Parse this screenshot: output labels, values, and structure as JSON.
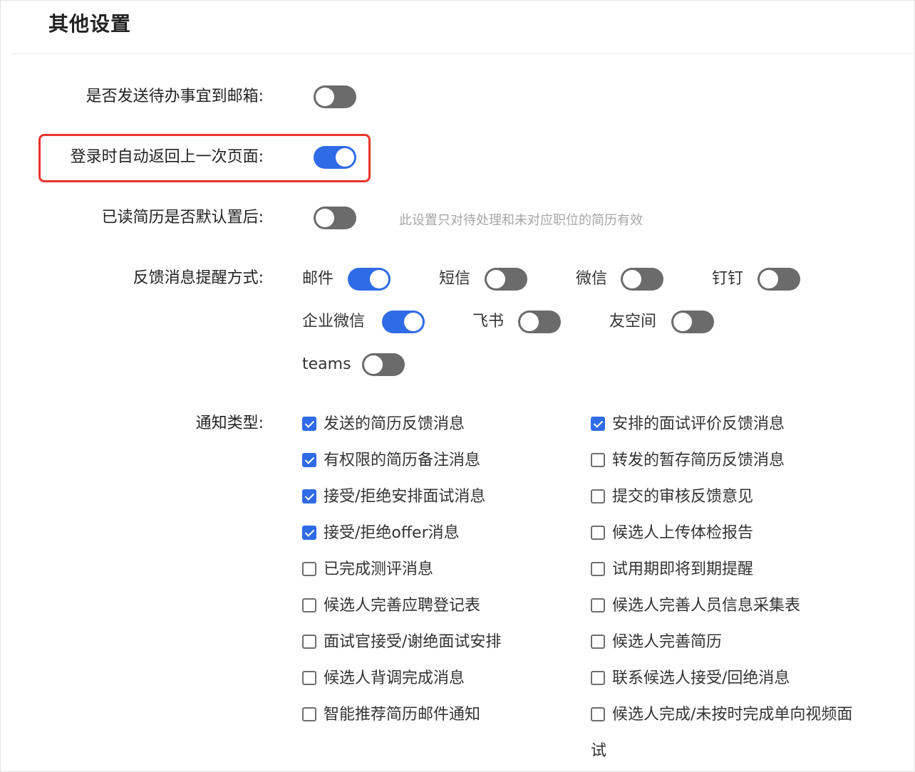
{
  "section_title": "其他设置",
  "settings": {
    "email_todo": {
      "label": "是否发送待办事宜到邮箱:",
      "enabled": false
    },
    "auto_return": {
      "label": "登录时自动返回上一次页面:",
      "enabled": true
    },
    "read_resume_last": {
      "label": "已读简历是否默认置后:",
      "enabled": false,
      "hint": "此设置只对待处理和未对应职位的简历有效"
    }
  },
  "reminder": {
    "label": "反馈消息提醒方式:",
    "channels": [
      {
        "label": "邮件",
        "enabled": true
      },
      {
        "label": "短信",
        "enabled": false
      },
      {
        "label": "微信",
        "enabled": false
      },
      {
        "label": "钉钉",
        "enabled": false
      },
      {
        "label": "企业微信",
        "enabled": true
      },
      {
        "label": "飞书",
        "enabled": false
      },
      {
        "label": "友空间",
        "enabled": false
      },
      {
        "label": "teams",
        "enabled": false
      }
    ]
  },
  "notify": {
    "label": "通知类型:",
    "left": [
      {
        "label": "发送的简历反馈消息",
        "checked": true
      },
      {
        "label": "有权限的简历备注消息",
        "checked": true
      },
      {
        "label": "接受/拒绝安排面试消息",
        "checked": true
      },
      {
        "label": "接受/拒绝offer消息",
        "checked": true
      },
      {
        "label": "已完成测评消息",
        "checked": false
      },
      {
        "label": "候选人完善应聘登记表",
        "checked": false
      },
      {
        "label": "面试官接受/谢绝面试安排",
        "checked": false
      },
      {
        "label": "候选人背调完成消息",
        "checked": false
      },
      {
        "label": "智能推荐简历邮件通知",
        "checked": false
      }
    ],
    "right": [
      {
        "label": "安排的面试评价反馈消息",
        "checked": true
      },
      {
        "label": "转发的暂存简历反馈消息",
        "checked": false
      },
      {
        "label": "提交的审核反馈意见",
        "checked": false
      },
      {
        "label": "候选人上传体检报告",
        "checked": false
      },
      {
        "label": "试用期即将到期提醒",
        "checked": false
      },
      {
        "label": "候选人完善人员信息采集表",
        "checked": false
      },
      {
        "label": "候选人完善简历",
        "checked": false
      },
      {
        "label": "联系候选人接受/回绝消息",
        "checked": false
      },
      {
        "label": "候选人完成/未按时完成单向视频面",
        "checked": false,
        "wrap": "试"
      }
    ]
  },
  "colors": {
    "accent": "#2f6be6",
    "switch_off": "#6b6b6b",
    "highlight": "#e8342c",
    "hint": "#a6a6a6"
  }
}
